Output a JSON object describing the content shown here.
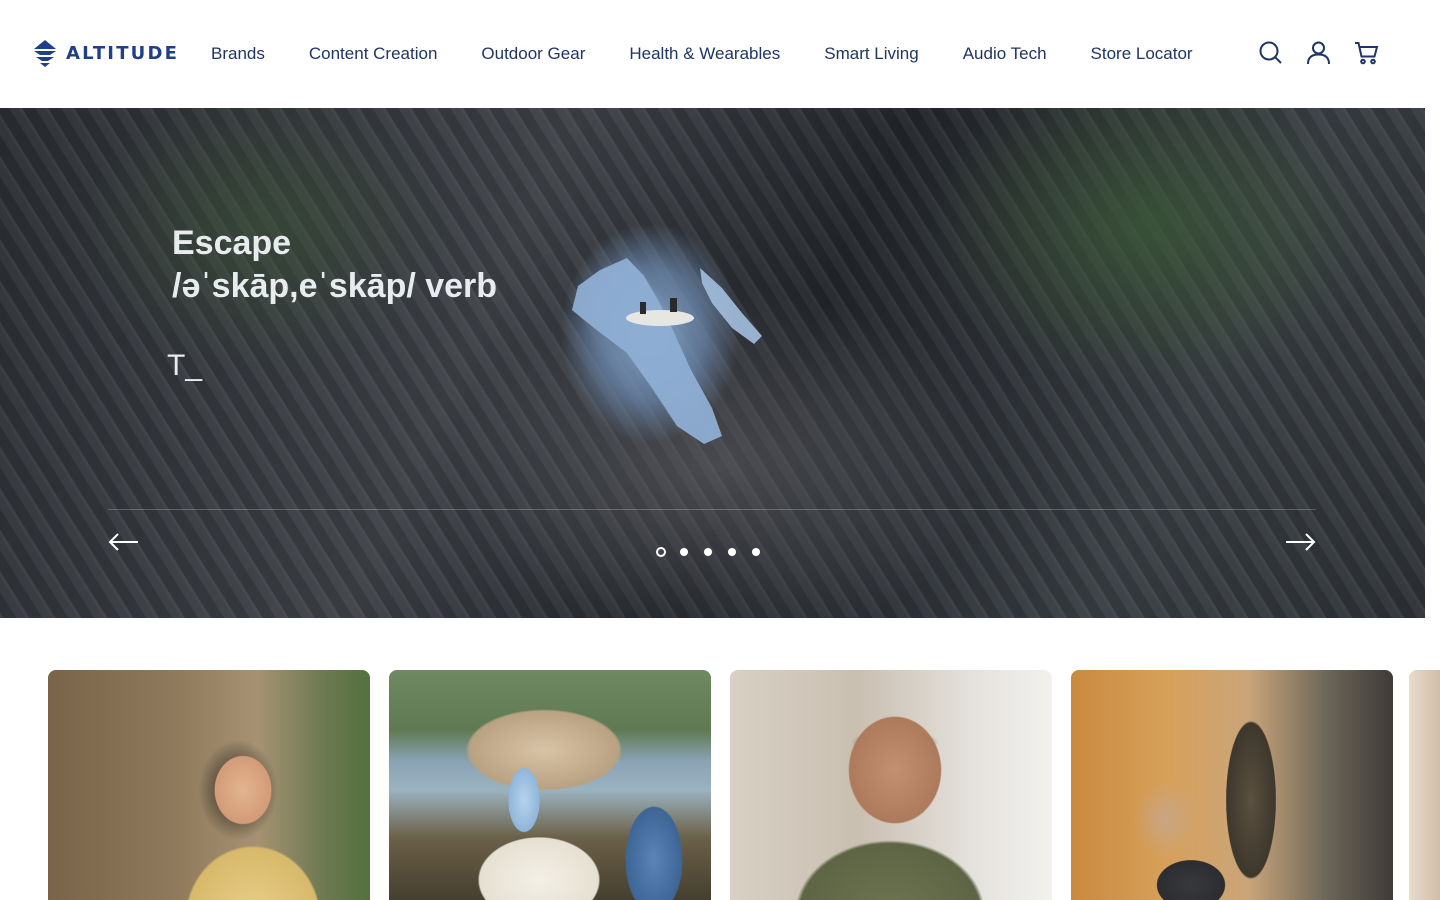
{
  "brand": {
    "name": "ALTITUDE",
    "logo_icon": "layered-diamond-logo",
    "color": "#1f3f86"
  },
  "nav": {
    "items": [
      {
        "label": "Brands"
      },
      {
        "label": "Content Creation"
      },
      {
        "label": "Outdoor Gear"
      },
      {
        "label": "Health & Wearables"
      },
      {
        "label": "Smart Living"
      },
      {
        "label": "Audio Tech"
      },
      {
        "label": "Store Locator"
      }
    ]
  },
  "header_icons": [
    "search-icon",
    "account-icon",
    "cart-icon"
  ],
  "hero": {
    "title_line1": "Escape",
    "title_line2": "/əˈskāp,eˈskāp/ verb",
    "typing_text": "T_",
    "slides_total": 5,
    "active_slide": 1,
    "prev_icon": "arrow-left-icon",
    "next_icon": "arrow-right-icon"
  },
  "cards": [
    {
      "name": "content-creation-card",
      "image": "woman-with-neck-camera"
    },
    {
      "name": "outdoor-gear-card",
      "image": "camping-cooler-tumbler-backpack"
    },
    {
      "name": "wearables-card",
      "image": "man-wearing-smart-glasses"
    },
    {
      "name": "smart-living-card",
      "image": "couple-with-home-power-station"
    }
  ],
  "colors": {
    "nav_text": "#1f3566",
    "hero_text": "#e9ecef"
  }
}
